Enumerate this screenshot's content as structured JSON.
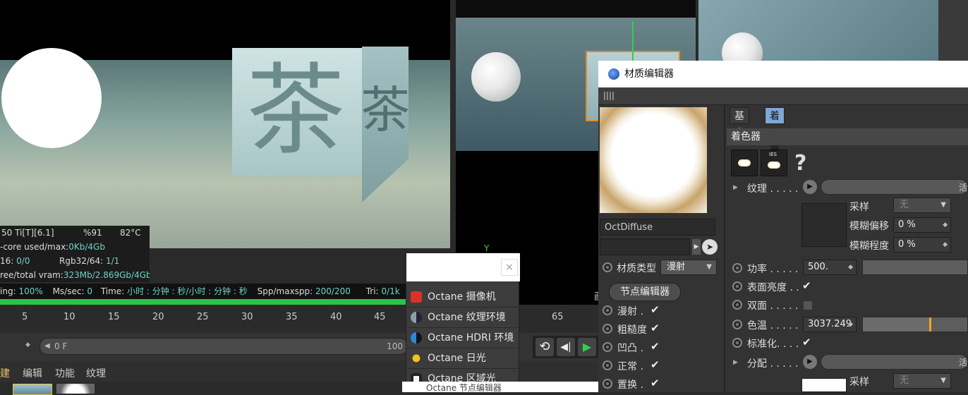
{
  "render_stats": {
    "gpu": "50 Ti[T][6.1]",
    "gpu_usage": "%91",
    "gpu_temp": "82°C",
    "outcore_label": "-core used/max:",
    "outcore_value": "0Kb/4Gb",
    "row3_a_label": "16:",
    "row3_a_value": "0/0",
    "row3_b_label": "Rgb32/64:",
    "row3_b_value": "1/1",
    "vram_label": "ree/total vram:",
    "vram_value": "323Mb/2.869Gb/4Gb",
    "progress_label": "ing:",
    "progress_value": "100%",
    "ms_label": "Ms/sec:",
    "ms_value": "0",
    "time_label": "Time:",
    "time_value": "小时 : 分钟 : 秒/小时 : 分钟 : 秒",
    "spp_label": "Spp/maxspp:",
    "spp_value": "200/200",
    "tri_label": "Tri:",
    "tri_value": "0/1k",
    "progress_fraction": 1.0
  },
  "scene_text": {
    "cube_glyph": "茶"
  },
  "timeline": {
    "ticks": [
      "5",
      "10",
      "15",
      "20",
      "25",
      "30",
      "35",
      "40",
      "45",
      "65"
    ],
    "slider_start": "0 F",
    "slider_end": "100"
  },
  "menu": {
    "items": [
      "建",
      "编辑",
      "功能",
      "纹理"
    ]
  },
  "popup": {
    "close": "×",
    "items": [
      {
        "label": "Octane 摄像机",
        "icon": "camera-icon",
        "color": "#d9322b"
      },
      {
        "label": "Octane 纹理环境",
        "icon": "texture-environment-icon",
        "color": "#8aa0a8"
      },
      {
        "label": "Octane HDRI 环境",
        "icon": "hdri-environment-icon",
        "color": "#2f86d9"
      },
      {
        "label": "Octane 日光",
        "icon": "sun-icon",
        "color": "#f2c31b"
      },
      {
        "label": "Octane 区域光",
        "icon": "area-light-icon",
        "color": "#f4f4f4"
      }
    ]
  },
  "material_editor": {
    "title": "材质编辑器",
    "material_name": "OctDiffuse",
    "material_type_label": "材质类型",
    "material_type_value": "漫射",
    "node_editor_button": "节点编辑器",
    "channels": [
      {
        "label": "漫射 .",
        "checked": "✔"
      },
      {
        "label": "粗糙度",
        "checked": "✔"
      },
      {
        "label": "凹凸 .",
        "checked": "✔"
      },
      {
        "label": "正常 .",
        "checked": "✔"
      },
      {
        "label": "置换 .",
        "checked": "✔"
      }
    ],
    "tabs": [
      "基本",
      "着色器"
    ],
    "active_tab": "着色器",
    "section_title": "着色器",
    "help": "?",
    "ies_label": "IES",
    "texture_label": "纹理 . . . . .",
    "sampling_label": "采样",
    "sampling_value": "无",
    "blur_offset_label": "模糊偏移",
    "blur_offset_value": "0 %",
    "blur_degree_label": "模糊程度",
    "blur_degree_value": "0 %",
    "power_label": "功率 . . . . .",
    "power_value": "500.",
    "surface_brightness_label": "表面亮度 . .",
    "surface_brightness_checked": "✔",
    "double_sided_label": "双面 . . . . .",
    "color_temp_label": "色温 . . . . .",
    "color_temp_value": "3037.249",
    "normalize_label": "标准化. . . .",
    "normalize_checked": "✔",
    "distribution_label": "分配 . . . . .",
    "sampling2_label": "采样",
    "sampling2_value": "无",
    "slider_edge_text": "活"
  },
  "viewport_side": {
    "label_cut": "画"
  },
  "bottom_window": {
    "text": "Octane 节点编辑器"
  },
  "axis_label": "Y"
}
